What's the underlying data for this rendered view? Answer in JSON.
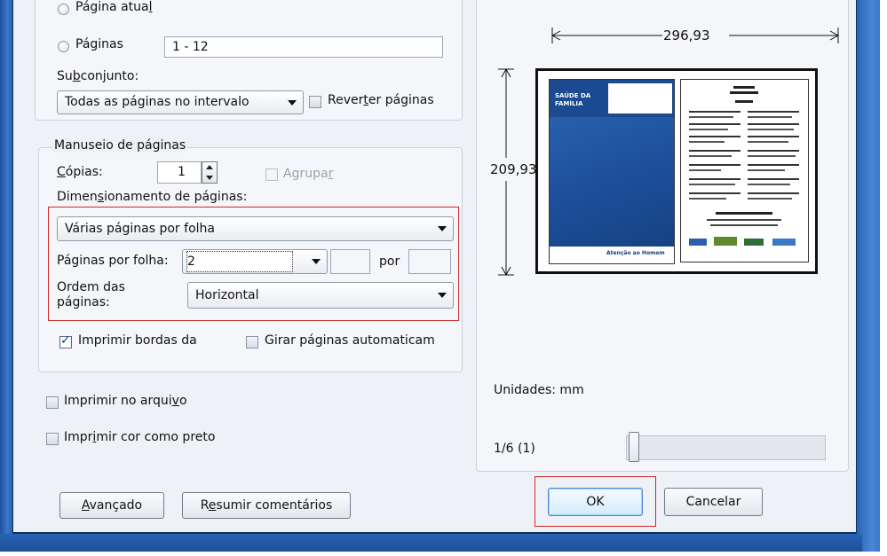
{
  "print_range": {
    "current_page_prefix": "Página atua",
    "current_page_mnemonic": "l",
    "pages_prefix": "Pá",
    "pages_mnemonic": "g",
    "pages_suffix": "inas",
    "pages_value": "1 - 12",
    "subset_prefix": "Su",
    "subset_mnemonic": "b",
    "subset_suffix": "conjunto:",
    "subset_value": "Todas as páginas no intervalo",
    "reverse_prefix": "Rever",
    "reverse_mnemonic": "t",
    "reverse_suffix": "er páginas"
  },
  "page_handling": {
    "title": "Manuseio de páginas",
    "copies_mnemonic": "C",
    "copies_suffix": "ópias:",
    "copies_value": "1",
    "collate_prefix": "Agrupa",
    "collate_mnemonic": "r",
    "scaling_prefix": "Dimen",
    "scaling_mnemonic": "s",
    "scaling_suffix": "ionamento de páginas:",
    "scaling_value": "Várias páginas por folha",
    "pages_per_sheet_label": "Páginas por folha:",
    "pages_per_sheet_value": "2",
    "by_label": "por",
    "order_label_line1": "Ordem das",
    "order_label_line2": "páginas:",
    "order_value": "Horizontal",
    "borders_label": "Imprimir bordas da",
    "auto_rotate_label": "Girar páginas automaticam"
  },
  "options": {
    "print_to_file_prefix": "Imprimir no arqui",
    "print_to_file_mnemonic": "v",
    "print_to_file_suffix": "o",
    "print_black_prefix": "Impr",
    "print_black_mnemonic": "i",
    "print_black_suffix": "mir cor como preto"
  },
  "preview": {
    "width_value": "296,93",
    "height_value": "209,93",
    "units_label": "Unidades: mm",
    "page_indicator": "1/6 (1)",
    "cover_lines": [
      "SAÚDE DA",
      "FAMÍLIA"
    ],
    "cover_footer": "Atenção ao Homem"
  },
  "buttons": {
    "advanced_mnemonic": "A",
    "advanced_suffix": "vançado",
    "summarize_prefix": "R",
    "summarize_mnemonic": "e",
    "summarize_suffix": "sumir comentários",
    "ok": "OK",
    "cancel": "Cancelar"
  },
  "colors": {
    "highlight": "#d12a2a",
    "frame_blue": "#2a63b4",
    "cover_blue": "#1c4f9a"
  }
}
